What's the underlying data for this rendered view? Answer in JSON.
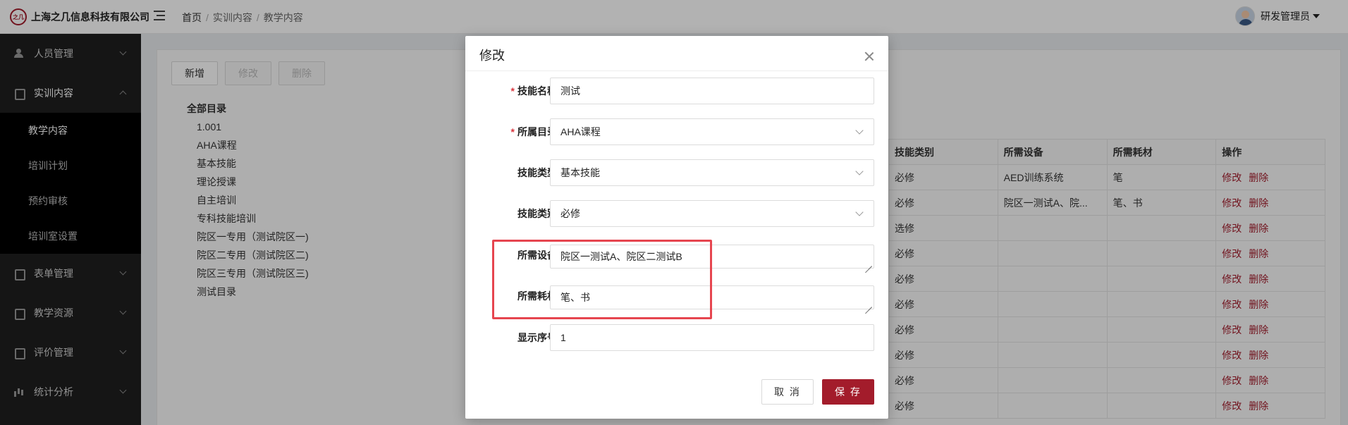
{
  "app": {
    "company": "上海之几信息科技有限公司",
    "logo_mark": "之几"
  },
  "breadcrumb": [
    "首页",
    "实训内容",
    "教学内容"
  ],
  "breadcrumb_sep": "/",
  "user": {
    "name": "研发管理员"
  },
  "sidebar": {
    "groups": [
      {
        "label": "人员管理",
        "icon": "user-icon"
      },
      {
        "label": "实训内容",
        "icon": "book-icon",
        "open": true,
        "items": [
          {
            "label": "教学内容",
            "active": true
          },
          {
            "label": "培训计划"
          },
          {
            "label": "预约审核"
          },
          {
            "label": "培训室设置"
          }
        ]
      },
      {
        "label": "表单管理",
        "icon": "form-icon"
      },
      {
        "label": "教学资源",
        "icon": "resource-icon"
      },
      {
        "label": "评价管理",
        "icon": "evaluate-icon"
      },
      {
        "label": "统计分析",
        "icon": "chart-icon"
      }
    ]
  },
  "toolbar": {
    "add": "新增",
    "edit": "修改",
    "delete": "删除"
  },
  "tree": {
    "root": "全部目录",
    "items": [
      "1.001",
      "AHA课程",
      "基本技能",
      "理论授课",
      "自主培训",
      "专科技能培训",
      "院区一专用（测试院区一)",
      "院区二专用（测试院区二)",
      "院区三专用（测试院区三)",
      "测试目录"
    ]
  },
  "table": {
    "headers": [
      "技能类别",
      "所需设备",
      "所需耗材",
      "操作"
    ],
    "rows": [
      {
        "category": "必修",
        "equipment": "AED训练系统",
        "materials": "笔"
      },
      {
        "category": "必修",
        "equipment": "院区一测试A、院...",
        "materials": "笔、书"
      },
      {
        "category": "选修",
        "equipment": "",
        "materials": ""
      },
      {
        "category": "必修",
        "equipment": "",
        "materials": ""
      },
      {
        "category": "必修",
        "equipment": "",
        "materials": ""
      },
      {
        "category": "必修",
        "equipment": "",
        "materials": ""
      },
      {
        "category": "必修",
        "equipment": "",
        "materials": ""
      },
      {
        "category": "必修",
        "equipment": "",
        "materials": ""
      },
      {
        "category": "必修",
        "equipment": "",
        "materials": ""
      },
      {
        "category": "必修",
        "equipment": "",
        "materials": ""
      }
    ],
    "op_edit": "修改",
    "op_delete": "删除"
  },
  "modal": {
    "title": "修改",
    "fields": {
      "skill_name": {
        "label": "技能名称",
        "value": "测试",
        "required": true
      },
      "catalog": {
        "label": "所属目录",
        "value": "AHA课程",
        "required": true
      },
      "skill_type": {
        "label": "技能类型",
        "value": "基本技能"
      },
      "skill_category": {
        "label": "技能类别",
        "value": "必修"
      },
      "equipment": {
        "label": "所需设备",
        "value": "院区一测试A、院区二测试B"
      },
      "materials": {
        "label": "所需耗材",
        "value": "笔、书"
      },
      "order": {
        "label": "显示序号",
        "value": "1"
      }
    },
    "cancel": "取 消",
    "save": "保 存"
  },
  "colors": {
    "brand": "#a31c2b",
    "highlight": "#e6454f",
    "sidebar": "#1f1f1f"
  }
}
